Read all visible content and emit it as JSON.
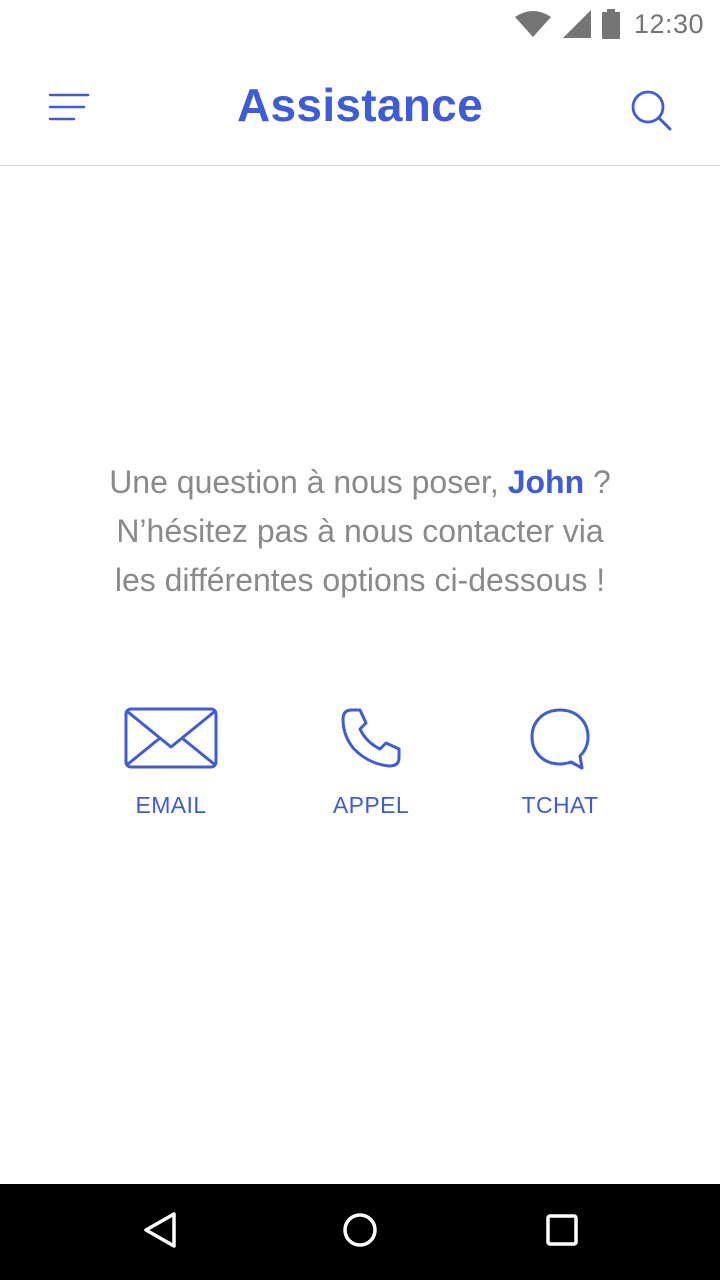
{
  "status_bar": {
    "time": "12:30",
    "icons": [
      "wifi-icon",
      "signal-icon",
      "battery-icon"
    ]
  },
  "app_bar": {
    "title": "Assistance",
    "menu_icon": "menu-icon",
    "search_icon": "search-icon"
  },
  "message": {
    "line1_prefix": "Une question à nous poser,",
    "user_name": "John",
    "line1_suffix": "?",
    "line2": "N’hésitez pas à nous contacter via",
    "line3": "les différentes options ci-dessous !"
  },
  "contact_options": [
    {
      "label": "EMAIL",
      "icon": "envelope-icon"
    },
    {
      "label": "APPEL",
      "icon": "phone-icon"
    },
    {
      "label": "TCHAT",
      "icon": "chat-bubble-icon"
    }
  ],
  "nav_bar": {
    "icons": [
      "back-icon",
      "home-icon",
      "recents-icon"
    ]
  },
  "colors": {
    "accent": "#3f5bd6",
    "body_text": "#8a8a8a",
    "status_icons": "#757575",
    "nav_background": "#000000",
    "divider": "#d6d6d6"
  }
}
